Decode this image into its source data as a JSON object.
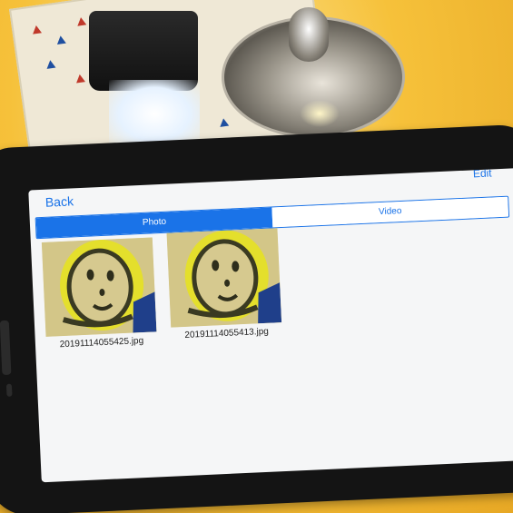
{
  "app": {
    "back_label": "Back",
    "edit_label": "Edit"
  },
  "tabs": [
    {
      "label": "Photo",
      "selected": true
    },
    {
      "label": "Video",
      "selected": false
    }
  ],
  "photos": [
    {
      "filename": "20191114055425.jpg"
    },
    {
      "filename": "20191114055413.jpg"
    }
  ],
  "colors": {
    "accent": "#1a73e8",
    "screen_bg": "#f5f6f7",
    "table": "#f6c13a"
  }
}
